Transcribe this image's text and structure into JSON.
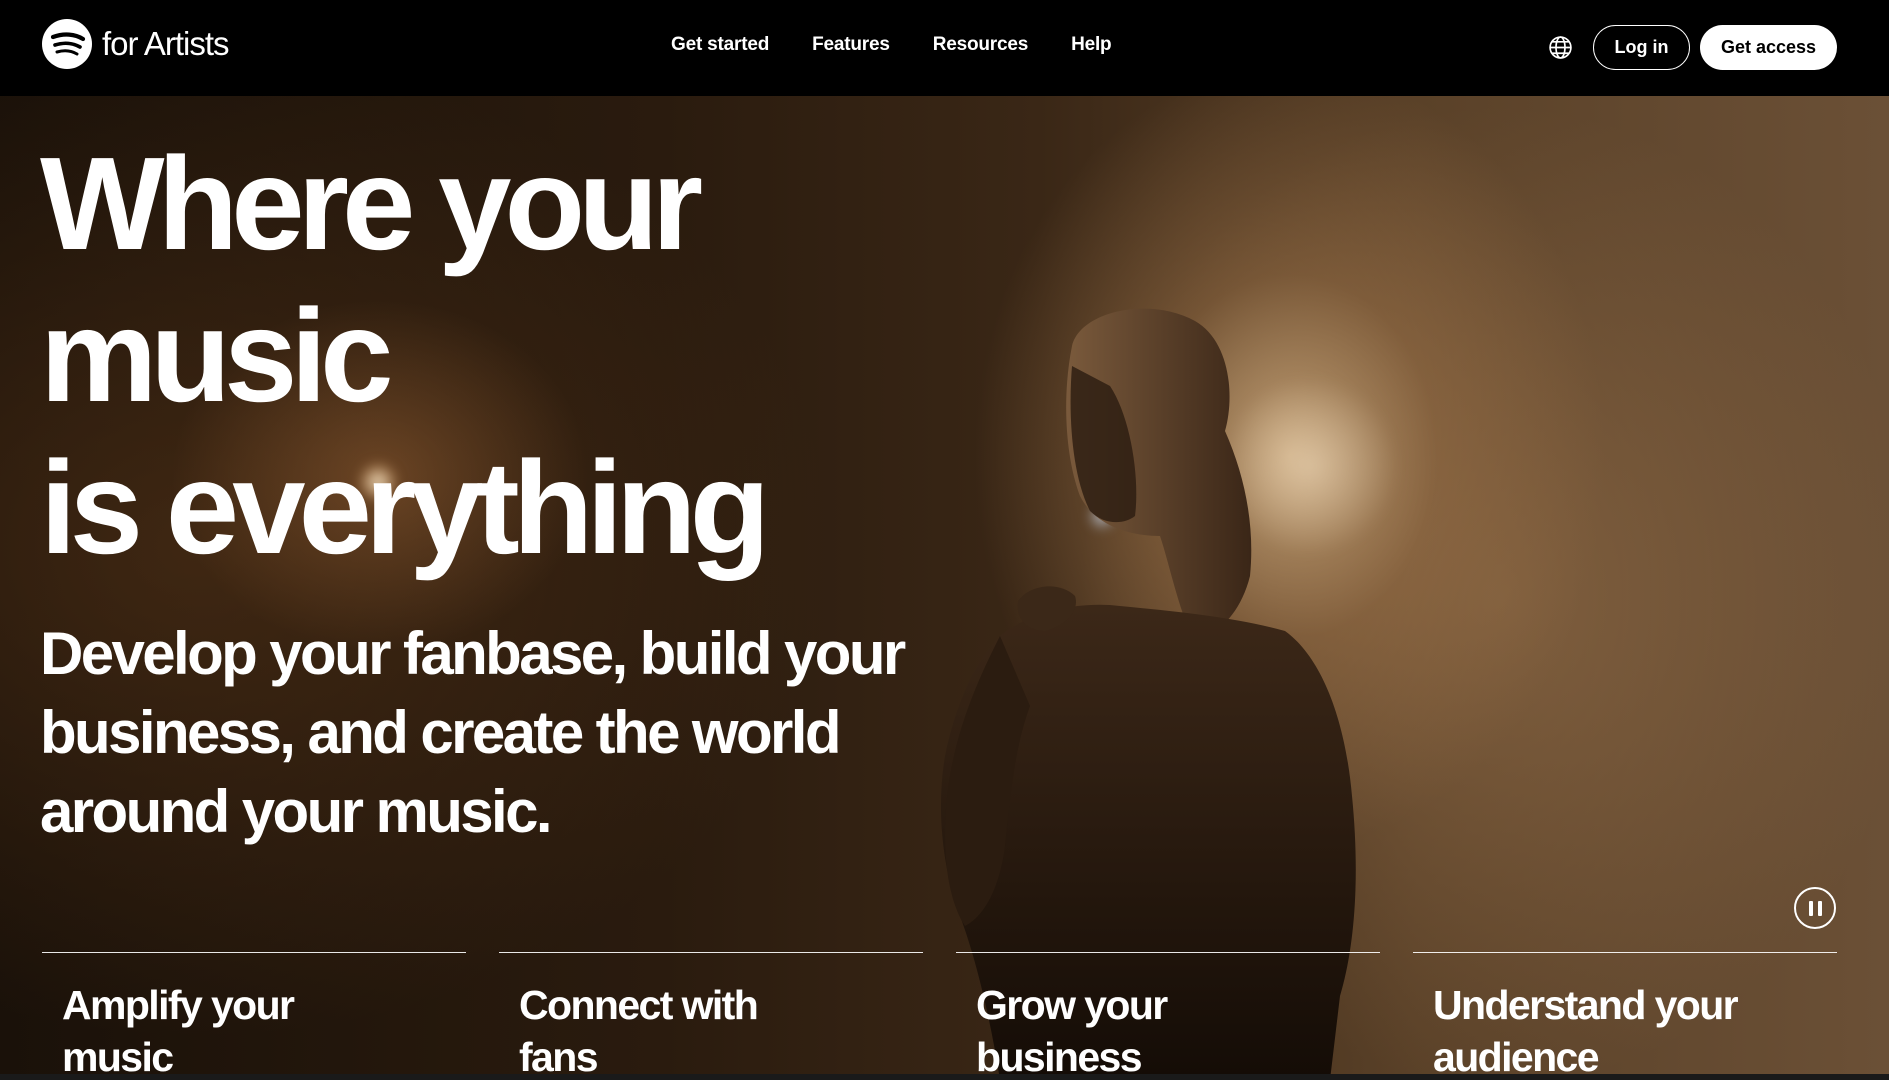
{
  "nav": {
    "brand_text": "for Artists",
    "links": [
      "Get started",
      "Features",
      "Resources",
      "Help"
    ],
    "login_label": "Log in",
    "access_label": "Get access"
  },
  "hero": {
    "headline_line1": "Where your",
    "headline_line2": "music",
    "headline_line3": "is everything",
    "subhead": "Develop your fanbase, build your business, and create the world around your music.",
    "features": [
      "Amplify your music",
      "Connect with fans",
      "Grow your business",
      "Understand your audience"
    ]
  },
  "colors": {
    "nav_background": "#000000",
    "text": "#ffffff",
    "accent_button_bg": "#ffffff"
  },
  "icons": {
    "brand": "spotify-logo-icon",
    "language": "globe-icon",
    "media": "pause-icon"
  }
}
